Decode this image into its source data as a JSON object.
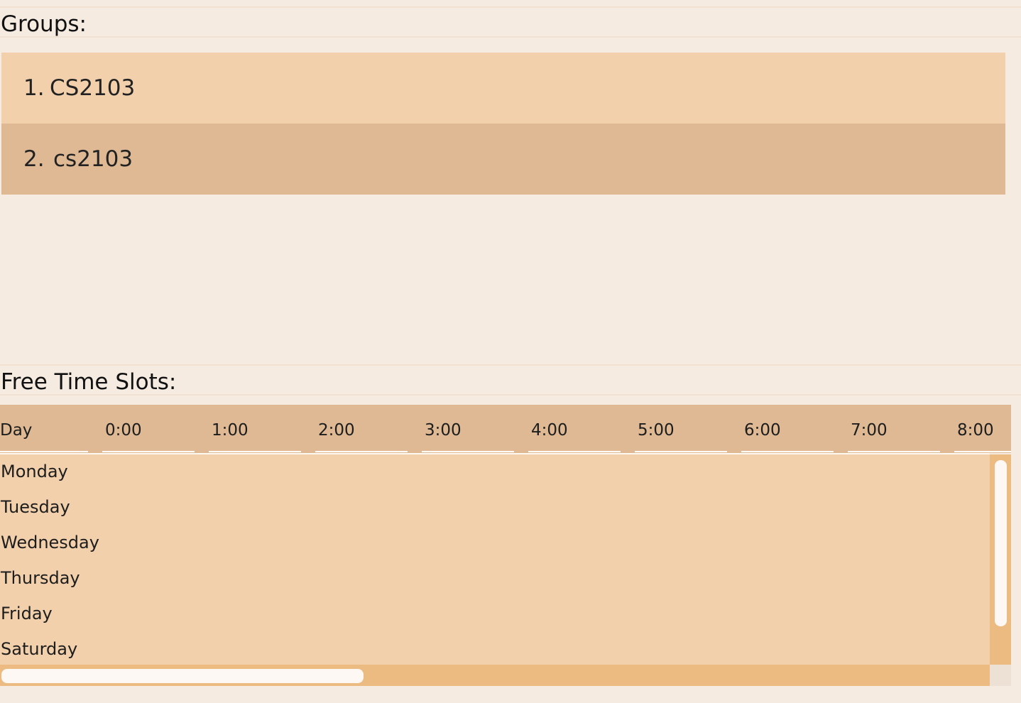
{
  "groups": {
    "title": "Groups:",
    "items": [
      {
        "index": "1.",
        "name": "CS2103"
      },
      {
        "index": "2.",
        "name": "cs2103"
      }
    ]
  },
  "free_time": {
    "title": "Free Time Slots:",
    "columns": [
      "Day",
      "0:00",
      "1:00",
      "2:00",
      "3:00",
      "4:00",
      "5:00",
      "6:00",
      "7:00",
      "8:00"
    ],
    "days": [
      "Monday",
      "Tuesday",
      "Wednesday",
      "Thursday",
      "Friday",
      "Saturday"
    ]
  },
  "colors": {
    "background": "#f5ebe1",
    "row_light": "#f2d0ab",
    "row_dark": "#deb994",
    "scrollbar": "#ecbb82"
  }
}
